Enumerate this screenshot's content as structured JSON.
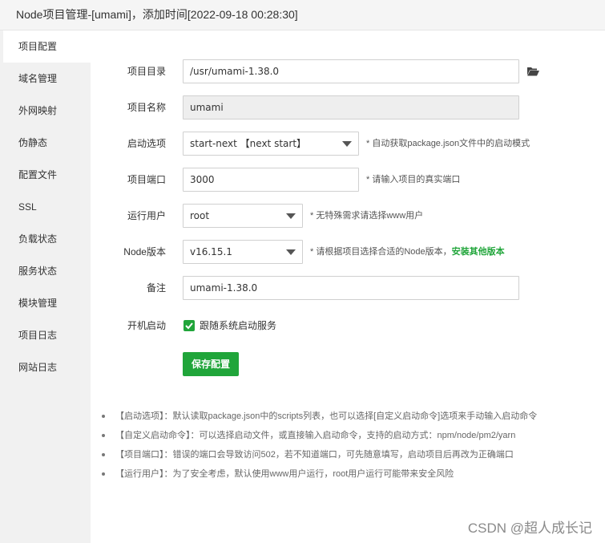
{
  "title": "Node项目管理-[umami]，添加时间[2022-09-18 00:28:30]",
  "sidebar": {
    "items": [
      {
        "label": "项目配置"
      },
      {
        "label": "域名管理"
      },
      {
        "label": "外网映射"
      },
      {
        "label": "伪静态"
      },
      {
        "label": "配置文件"
      },
      {
        "label": "SSL"
      },
      {
        "label": "负载状态"
      },
      {
        "label": "服务状态"
      },
      {
        "label": "模块管理"
      },
      {
        "label": "项目日志"
      },
      {
        "label": "网站日志"
      }
    ]
  },
  "form": {
    "project_dir": {
      "label": "项目目录",
      "value": "/usr/umami-1.38.0",
      "icon": "folder-icon"
    },
    "project_name": {
      "label": "项目名称",
      "value": "umami"
    },
    "start_option": {
      "label": "启动选项",
      "value": "start-next 【next start】",
      "hint": "* 自动获取package.json文件中的启动模式"
    },
    "project_port": {
      "label": "项目端口",
      "value": "3000",
      "hint": "* 请输入项目的真实端口"
    },
    "run_user": {
      "label": "运行用户",
      "value": "root",
      "hint": "* 无特殊需求请选择www用户"
    },
    "node_version": {
      "label": "Node版本",
      "value": "v16.15.1",
      "hint": "* 请根据项目选择合适的Node版本，",
      "hint_link": "安装其他版本"
    },
    "remark": {
      "label": "备注",
      "value": "umami-1.38.0"
    },
    "autostart": {
      "label": "开机启动",
      "checkbox_label": "跟随系统启动服务",
      "checked": true
    },
    "save_label": "保存配置"
  },
  "notes": [
    "【启动选项】：默认读取package.json中的scripts列表，也可以选择[自定义启动命令]选项来手动输入启动命令",
    "【自定义启动命令】：可以选择启动文件，或直接输入启动命令，支持的启动方式：npm/node/pm2/yarn",
    "【项目端口】：错误的端口会导致访问502，若不知道端口，可先随意填写，启动项目后再改为正确端口",
    "【运行用户】：为了安全考虑，默认使用www用户运行，root用户运行可能带来安全风险"
  ],
  "watermark": "CSDN @超人成长记",
  "colors": {
    "accent": "#20a53a",
    "sidebar_bg": "#f1f1f1",
    "title_bg": "#f5f5f5"
  }
}
